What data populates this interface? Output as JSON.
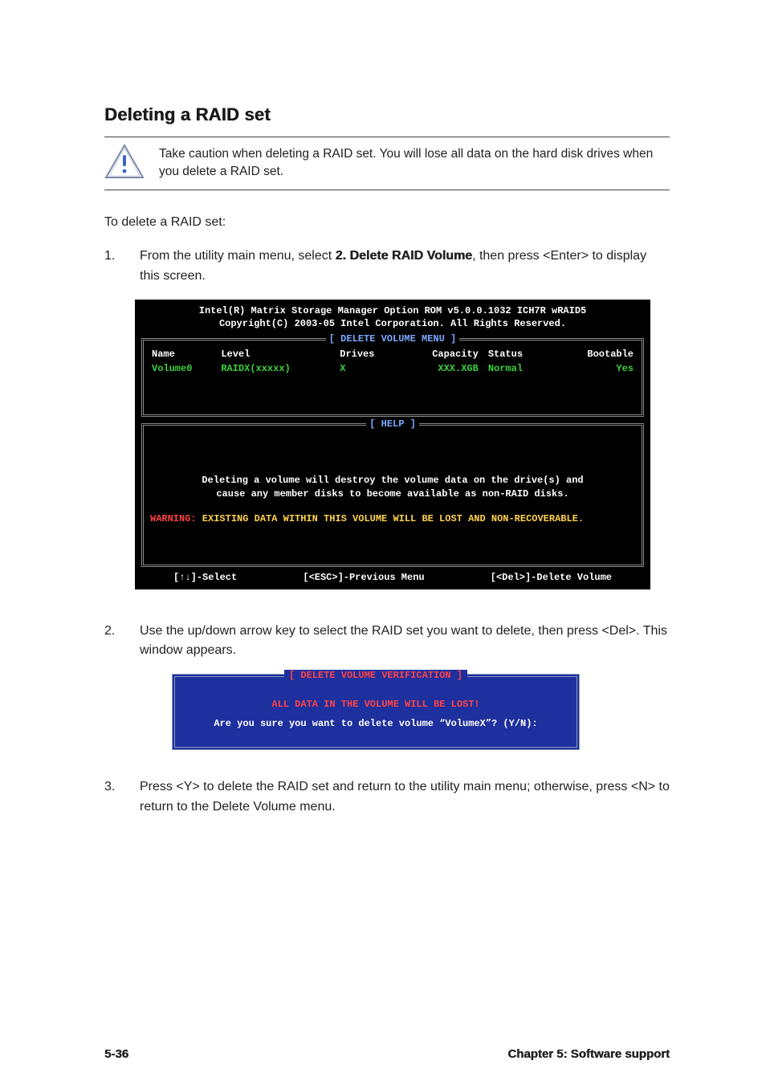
{
  "section_title": "Deleting a RAID set",
  "note_text": "Take caution when deleting a RAID set. You will lose all data on the hard disk drives when you delete a RAID set.",
  "intro": "To delete a RAID set:",
  "steps": {
    "s1_num": "1.",
    "s1_pre": "From the utility main menu, select ",
    "s1_bold": "2. Delete RAID Volume",
    "s1_post": ", then press <Enter> to display this screen.",
    "s2_num": "2.",
    "s2_text": "Use the up/down arrow key to select the RAID set you want to delete, then press <Del>. This window appears.",
    "s3_num": "3.",
    "s3_text": "Press <Y> to delete the RAID set and return to the utility main menu; otherwise, press <N> to return to the Delete Volume menu."
  },
  "bios": {
    "header1": "Intel(R) Matrix Storage Manager Option ROM v5.0.0.1032 ICH7R wRAID5",
    "header2": "Copyright(C) 2003-05 Intel Corporation. All Rights Reserved.",
    "menu_title": "[ DELETE VOLUME MENU ]",
    "cols": {
      "name": "Name",
      "level": "Level",
      "drives": "Drives",
      "capacity": "Capacity",
      "status": "Status",
      "bootable": "Bootable"
    },
    "row": {
      "name": "Volume0",
      "level": "RAIDX(xxxxx)",
      "drives": "X",
      "capacity": "XXX.XGB",
      "status": "Normal",
      "bootable": "Yes"
    },
    "help_title": "[ HELP ]",
    "help_msg1": "Deleting a volume will destroy the volume data on the drive(s) and",
    "help_msg2": "cause any member disks to become available as non-RAID disks.",
    "warn_label": "WARNING:",
    "warn_text": " EXISTING DATA WITHIN THIS VOLUME WILL BE LOST AND NON-RECOVERABLE.",
    "key_select": "[↑↓]-Select",
    "key_prev": "[<ESC>]-Previous Menu",
    "key_del": "[<Del>]-Delete Volume"
  },
  "dialog": {
    "title": "[ DELETE VOLUME VERIFICATION ]",
    "warn": "ALL DATA IN THE VOLUME WILL BE LOST!",
    "question": "Are you sure you want to delete volume “VolumeX”? (Y/N):"
  },
  "footer": {
    "page": "5-36",
    "chapter": "Chapter 5: Software support"
  }
}
